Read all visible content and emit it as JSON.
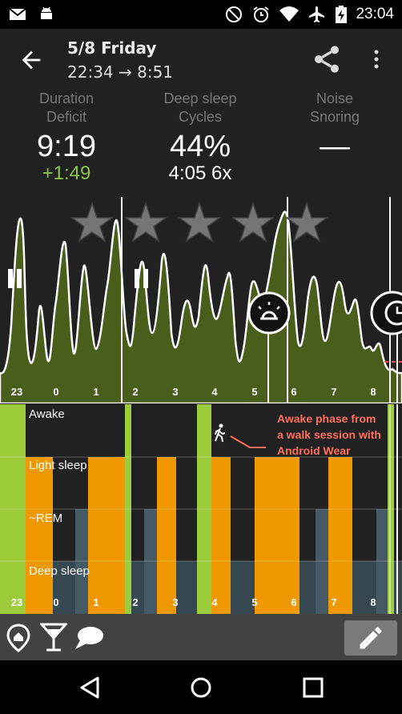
{
  "status_bar": {
    "time": "23:04"
  },
  "header": {
    "title": "5/8 Friday",
    "subtitle": "22:34 → 8:51"
  },
  "stats": [
    {
      "label_line1": "Duration",
      "label_line2": "Deficit",
      "value": "9:19",
      "secondary": "+1:49"
    },
    {
      "label_line1": "Deep sleep",
      "label_line2": "Cycles",
      "value": "44%",
      "secondary": "4:05 6x"
    },
    {
      "label_line1": "Noise",
      "label_line2": "Snoring",
      "value": "—",
      "secondary": ""
    }
  ],
  "rating": {
    "stars": 5
  },
  "hour_ticks": [
    "23",
    "0",
    "1",
    "2",
    "3",
    "4",
    "5",
    "6",
    "7",
    "8"
  ],
  "hypnogram": {
    "labels": {
      "awake": "Awake",
      "light": "Light sleep",
      "rem": "~REM",
      "deep": "Deep sleep"
    },
    "annotation_lines": [
      "Awake phase from",
      "a walk session with",
      "Android Wear"
    ]
  },
  "colors": {
    "accent_green": "#8bc34a",
    "awake_green": "#9ccc3b",
    "light_orange": "#f09800",
    "rem_gray": "#455a64",
    "deep_gray": "#37474f",
    "graph_fill": "#4a5e1c",
    "annotation": "#ff6f5c"
  },
  "icons": [
    "gmail-icon",
    "android-icon",
    "dnd-icon",
    "alarm-icon",
    "wifi-icon",
    "airplane-icon",
    "battery-charging-icon",
    "back-arrow-icon",
    "share-icon",
    "more-vert-icon",
    "pause-icon",
    "alarm-clock-icon",
    "walk-icon",
    "home-pin-icon",
    "cocktail-icon",
    "comment-icon",
    "pencil-icon",
    "nav-back-icon",
    "nav-home-icon",
    "nav-recents-icon"
  ]
}
